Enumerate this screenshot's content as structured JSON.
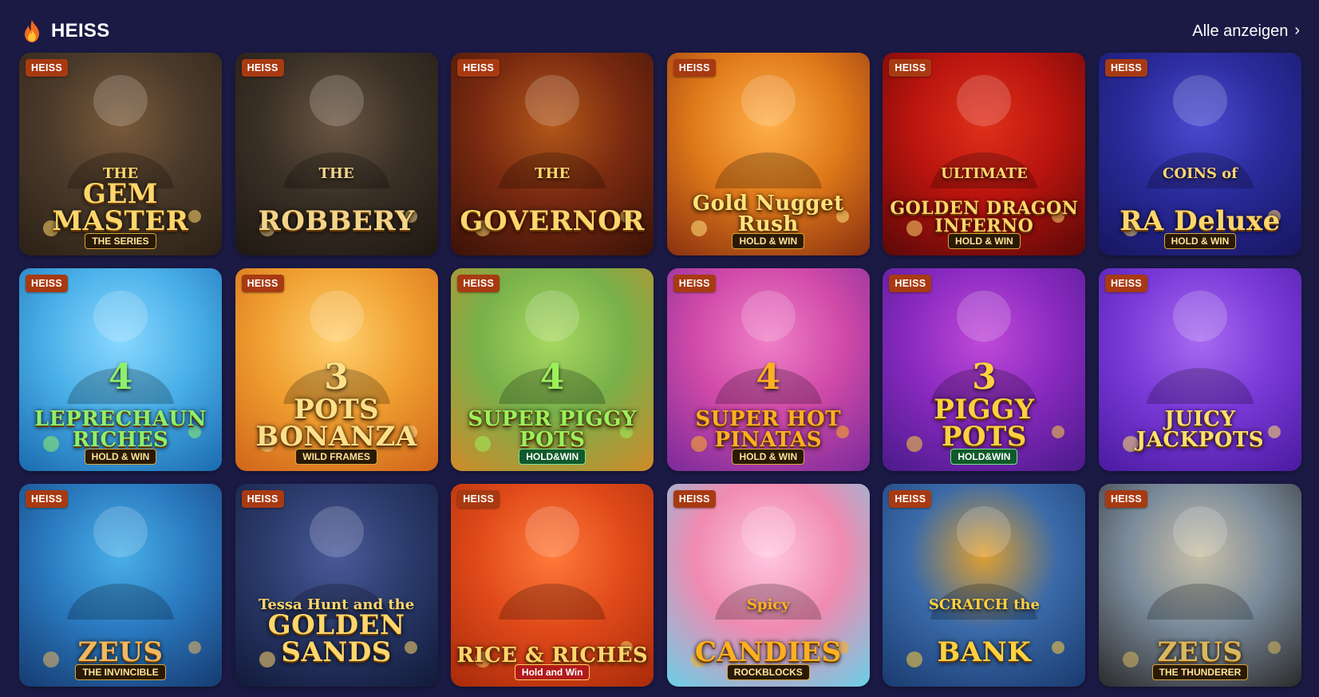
{
  "section": {
    "title": "HEISS",
    "see_all_label": "Alle anzeigen"
  },
  "tiles": [
    {
      "badge": "HEISS",
      "kicker": "THE",
      "title": "GEM MASTER",
      "sub": "THE SERIES",
      "bg": [
        "#4a3a2a",
        "#2b2016",
        "#7a5a3a"
      ],
      "accent": "#ffd66b"
    },
    {
      "badge": "HEISS",
      "kicker": "THE",
      "title": "ROBBERY",
      "sub": "",
      "bg": [
        "#3a3026",
        "#1e1812",
        "#6a5642"
      ],
      "accent": "#f2d48a"
    },
    {
      "badge": "HEISS",
      "kicker": "THE",
      "title": "GOVERNOR",
      "sub": "",
      "bg": [
        "#7a2a10",
        "#3a1208",
        "#b2581a"
      ],
      "accent": "#ffd66b"
    },
    {
      "badge": "HEISS",
      "kicker": "",
      "title": "Gold Nugget Rush",
      "sub": "HOLD & WIN",
      "bg": [
        "#e07a1a",
        "#8a3010",
        "#ffb04a"
      ],
      "accent": "#ffe27a"
    },
    {
      "badge": "HEISS",
      "kicker": "ULTIMATE",
      "title": "GOLDEN DRAGON INFERNO",
      "sub": "HOLD & WIN",
      "bg": [
        "#b8140e",
        "#5a0808",
        "#e0301a"
      ],
      "accent": "#ffd66b"
    },
    {
      "badge": "HEISS",
      "kicker": "COINS of",
      "title": "RA Deluxe",
      "sub": "HOLD & WIN",
      "bg": [
        "#2a2a9a",
        "#161660",
        "#4a4ad0"
      ],
      "accent": "#ffd66b"
    },
    {
      "badge": "HEISS",
      "kicker": "4",
      "title": "LEPRECHAUN RICHES",
      "sub": "HOLD & WIN",
      "bg": [
        "#4ab0e8",
        "#1a6ab0",
        "#8ad8ff"
      ],
      "accent": "#8ef06a"
    },
    {
      "badge": "HEISS",
      "kicker": "3",
      "title": "POTS BONANZA",
      "sub": "WILD FRAMES",
      "bg": [
        "#f0a030",
        "#d0641a",
        "#ffd070"
      ],
      "accent": "#ffe08a"
    },
    {
      "badge": "HEISS",
      "kicker": "4",
      "title": "SUPER PIGGY POTS",
      "sub": "HOLD&WIN",
      "bg": [
        "#78b04a",
        "#d08a2a",
        "#a8d860"
      ],
      "accent": "#9cf05a"
    },
    {
      "badge": "HEISS",
      "kicker": "4",
      "title": "SUPER HOT PINATAS",
      "sub": "HOLD & WIN",
      "bg": [
        "#d04aa8",
        "#7a2a9a",
        "#f080c8"
      ],
      "accent": "#ffb020"
    },
    {
      "badge": "HEISS",
      "kicker": "3",
      "title": "PIGGY POTS",
      "sub": "HOLD&WIN",
      "bg": [
        "#8a2ac0",
        "#4a1a8a",
        "#c04ad8"
      ],
      "accent": "#ffd040"
    },
    {
      "badge": "HEISS",
      "kicker": "",
      "title": "JUICY JACKPOTS",
      "sub": "",
      "bg": [
        "#7a3ad8",
        "#4a1aa0",
        "#a86af0"
      ],
      "accent": "#ffe06a"
    },
    {
      "badge": "HEISS",
      "kicker": "",
      "title": "ZEUS",
      "sub": "THE INVINCIBLE",
      "bg": [
        "#2a7ac0",
        "#163a70",
        "#4ab0e8"
      ],
      "accent": "#f0b860"
    },
    {
      "badge": "HEISS",
      "kicker": "Tessa Hunt and the",
      "title": "GOLDEN SANDS",
      "sub": "",
      "bg": [
        "#2a3a6a",
        "#121a3a",
        "#4a5a9a"
      ],
      "accent": "#ffd66b"
    },
    {
      "badge": "HEISS",
      "kicker": "",
      "title": "RICE & RICHES",
      "sub": "Hold and Win",
      "bg": [
        "#e04a1a",
        "#a82a0a",
        "#ff7a3a"
      ],
      "accent": "#ffd66b"
    },
    {
      "badge": "HEISS",
      "kicker": "Spicy",
      "title": "CANDIES",
      "sub": "ROCKBLOCKS",
      "bg": [
        "#f08ab0",
        "#6ad0e8",
        "#ffc8e0"
      ],
      "accent": "#ffb020"
    },
    {
      "badge": "HEISS",
      "kicker": "SCRATCH the",
      "title": "BANK",
      "sub": "",
      "bg": [
        "#3a6aa8",
        "#1a3a70",
        "#e0a030"
      ],
      "accent": "#ffd040"
    },
    {
      "badge": "HEISS",
      "kicker": "",
      "title": "ZEUS",
      "sub": "THE THUNDERER",
      "bg": [
        "#7a8a9a",
        "#2a2a2a",
        "#c8c0a8"
      ],
      "accent": "#d8b860"
    }
  ]
}
